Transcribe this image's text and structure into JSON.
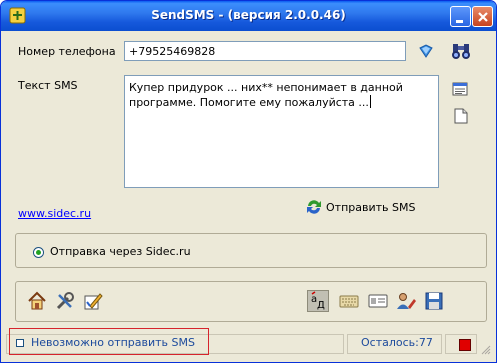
{
  "window": {
    "title": "SendSMS - (версия  2.0.0.46)"
  },
  "form": {
    "phone_label": "Номер телефона",
    "phone_value": "+79525469828",
    "sms_label": "Текст SMS",
    "sms_text": "Купер придурок ... них** непонимает в данной программе. Помогите ему пожалуйста ..."
  },
  "link": {
    "site": "www.sidec.ru"
  },
  "send": {
    "label": "Отправить SMS"
  },
  "delivery": {
    "option_label": "Отправка через Sidec.ru",
    "selected": true
  },
  "toolbar": {
    "icons": [
      "home-icon",
      "tools-icon",
      "edit-icon",
      "translit-icon",
      "keyboard-icon",
      "card-icon",
      "user-edit-icon",
      "save-icon"
    ],
    "translit_glyph": "aД"
  },
  "status": {
    "error_text": "Невозможно отправить SMS",
    "remaining": "Осталось:77",
    "indicator_color": "#e00000"
  },
  "colors": {
    "accent": "#0b4ed0",
    "error_border": "#d6242c",
    "link": "#0000ff"
  }
}
